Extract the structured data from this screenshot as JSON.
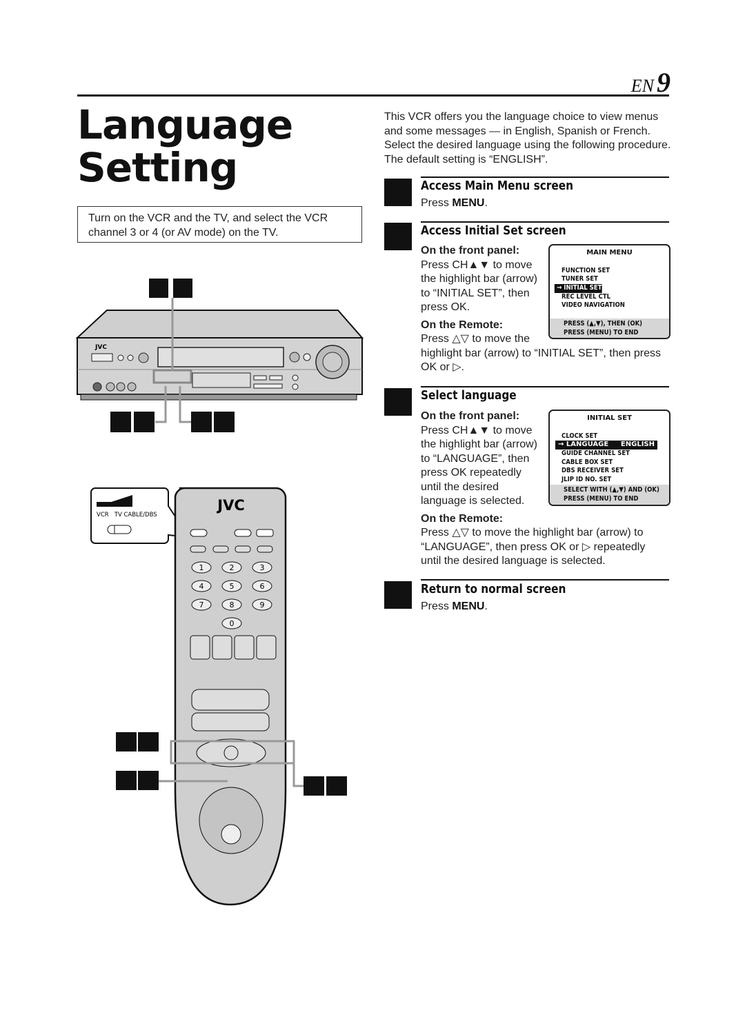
{
  "page": {
    "lang": "EN",
    "number": "9"
  },
  "title": [
    "Language",
    "Setting"
  ],
  "prep_note": [
    "Turn on the VCR and the TV, and select the VCR",
    "channel 3 or 4 (or AV mode) on the TV."
  ],
  "intro": [
    "This VCR offers you the language choice to view menus",
    "and some messages — in English, Spanish or French.",
    "Select the desired language using the following procedure.",
    "The default setting is “ENGLISH”."
  ],
  "steps": [
    {
      "title": "Access Main Menu screen",
      "text_pre": "Press ",
      "key": "MENU",
      "text_post": "."
    },
    {
      "title": "Access Initial Set screen",
      "front_label": "On the front panel:",
      "front_lines": [
        "Press CH▲▼ to move",
        "the highlight bar (arrow)",
        "to “INITIAL SET”, then",
        "press OK."
      ],
      "remote_label": "On the Remote:",
      "remote_lines": [
        "Press △▽ to move the",
        "highlight bar (arrow) to “INITIAL SET”, then press",
        "OK or ▷."
      ]
    },
    {
      "title": "Select language",
      "front_label": "On the front panel:",
      "front_lines": [
        "Press CH▲▼ to move",
        "the highlight bar (arrow)",
        "to “LANGUAGE”, then",
        "press OK repeatedly",
        "until the desired",
        "language is selected."
      ],
      "remote_label": "On the Remote:",
      "remote_lines": [
        "Press △▽ to move the highlight bar (arrow) to",
        "“LANGUAGE”, then press OK or ▷ repeatedly",
        "until the desired language is selected."
      ]
    },
    {
      "title": "Return to normal screen",
      "text_pre": "Press ",
      "key": "MENU",
      "text_post": "."
    }
  ],
  "main_menu": {
    "heading": "MAIN MENU",
    "items": [
      "FUNCTION SET",
      "TUNER SET",
      "INITIAL SET",
      "REC LEVEL CTL",
      "VIDEO NAVIGATION"
    ],
    "selected": "INITIAL SET",
    "footer": [
      "PRESS (▲,▼), THEN (OK)",
      "PRESS (MENU) TO END"
    ]
  },
  "initial_set_menu": {
    "heading": "INITIAL SET",
    "items": [
      "CLOCK SET",
      "LANGUAGE",
      "GUIDE CHANNEL SET",
      "CABLE BOX SET",
      "DBS RECEIVER SET",
      "JLIP ID NO. SET"
    ],
    "selected": "LANGUAGE",
    "selected_value": "ENGLISH",
    "footer": [
      "SELECT WITH (▲,▼) AND (OK)",
      "PRESS (MENU) TO END"
    ]
  },
  "illustration": {
    "brand": "JVC",
    "switch_labels": "VCR   TV CABLE/DBS",
    "keypad": [
      "1",
      "2",
      "3",
      "4",
      "5",
      "6",
      "7",
      "8",
      "9",
      "0"
    ]
  }
}
